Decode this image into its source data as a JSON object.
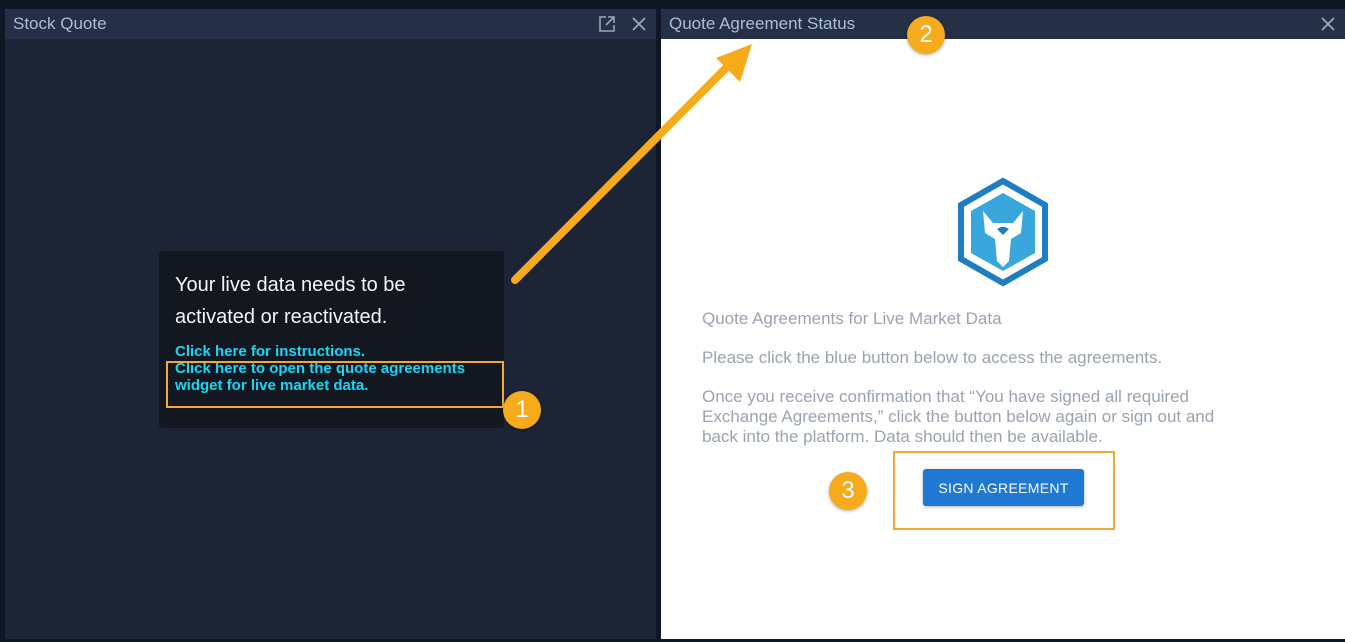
{
  "left_panel": {
    "title": "Stock Quote",
    "popup": {
      "headline_line1": "Your live data needs to be",
      "headline_line2": "activated or reactivated.",
      "link_instructions": "Click here for instructions.",
      "link_agreements_line1": "Click here to open the quote agreements",
      "link_agreements_line2": "widget for live market data."
    }
  },
  "right_panel": {
    "title": "Quote Agreement Status",
    "heading": "Quote Agreements for Live Market Data",
    "instruction": "Please click the blue button below to access the agreements.",
    "confirmation_line1": "Once you receive confirmation that “You have signed all required",
    "confirmation_line2": "Exchange Agreements,” click the button below again or sign out and",
    "confirmation_line3": "back into the platform. Data should then be available.",
    "button_label": "SIGN AGREEMENT"
  },
  "annotations": {
    "badge_1": "1",
    "badge_2": "2",
    "badge_3": "3",
    "accent_color": "#f5ab1c"
  },
  "icons": [
    "popout-icon",
    "close-icon",
    "shield-helmet-logo-icon"
  ]
}
